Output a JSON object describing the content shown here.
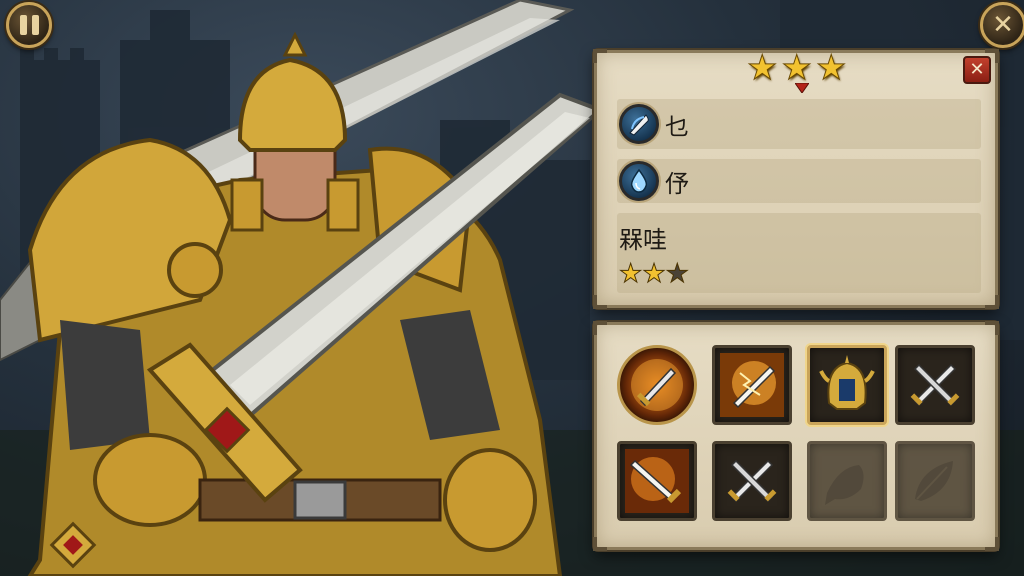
{
  "hud": {
    "pause_icon": "pause-icon",
    "close_icon": "close-icon"
  },
  "info_panel": {
    "rank_stars": [
      "★",
      "★",
      "★"
    ],
    "close_label": "✕",
    "stats": [
      {
        "icon": "blade-icon",
        "label": "乜"
      },
      {
        "icon": "water-drop-icon",
        "label": "伃"
      }
    ],
    "ability": {
      "label": "槑哇",
      "rating": 2,
      "rating_max": 3
    }
  },
  "skills": [
    {
      "icon": "flaming-sword-icon",
      "state": "equipped"
    },
    {
      "icon": "lightning-blade-icon",
      "state": "unlocked"
    },
    {
      "icon": "golden-helmet-icon",
      "state": "selected"
    },
    {
      "icon": "crossed-swords-icon",
      "state": "unlocked"
    },
    {
      "icon": "fire-sword-icon",
      "state": "unlocked"
    },
    {
      "icon": "crossed-swords-icon",
      "state": "unlocked"
    },
    {
      "icon": "fish-silhouette-icon",
      "state": "locked"
    },
    {
      "icon": "leaf-silhouette-icon",
      "state": "locked"
    }
  ],
  "colors": {
    "gold": "#f2c230",
    "parchment": "#e6dcc4",
    "frame": "#8a7a5a",
    "close_red": "#c2402d"
  }
}
